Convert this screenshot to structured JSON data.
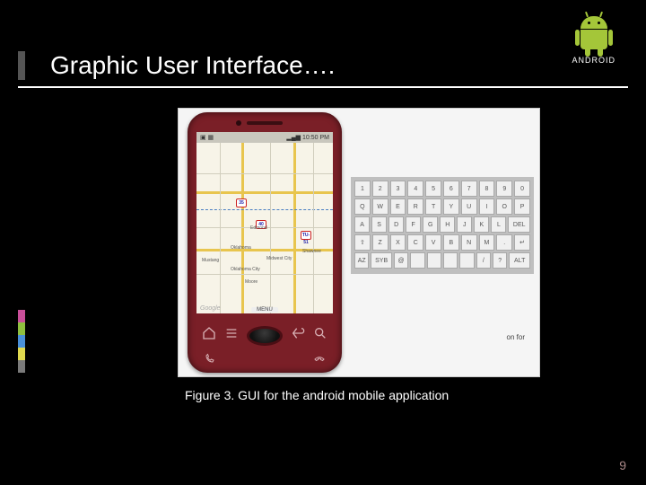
{
  "header": {
    "title": "Graphic User Interface….",
    "brand": "ANDROID"
  },
  "phone": {
    "statusbar": {
      "left_icons": "▣ ▦",
      "signal": "▂▄▆",
      "time": "10:50 PM"
    },
    "map": {
      "watermark": "Google",
      "menu_label": "MENU",
      "shields": [
        "40",
        "35",
        "TU-51"
      ],
      "cities": [
        "Oklahoma",
        "Mustang",
        "Oklahoma City",
        "Shawnee",
        "Moore",
        "Edmond",
        "Midwest City"
      ]
    }
  },
  "keyboard": {
    "row1": [
      "1",
      "2",
      "3",
      "4",
      "5",
      "6",
      "7",
      "8",
      "9",
      "0"
    ],
    "row2": [
      "Q",
      "W",
      "E",
      "R",
      "T",
      "Y",
      "U",
      "I",
      "O",
      "P"
    ],
    "row3": [
      "A",
      "S",
      "D",
      "F",
      "G",
      "H",
      "J",
      "K",
      "L",
      "DEL"
    ],
    "row4": [
      "⇧",
      "Z",
      "X",
      "C",
      "V",
      "B",
      "N",
      "M",
      ".",
      "↵"
    ],
    "row5": [
      "Az",
      "SYB",
      "@",
      "",
      "",
      "",
      "",
      "/",
      "?",
      "ALT"
    ]
  },
  "snippet_text": "on for",
  "caption": "Figure 3. GUI for the android mobile application",
  "page_number": "9",
  "stripe_colors": [
    "#c94f9a",
    "#8fbf3f",
    "#4a90d9",
    "#e0d94f",
    "#7a7a7a"
  ]
}
